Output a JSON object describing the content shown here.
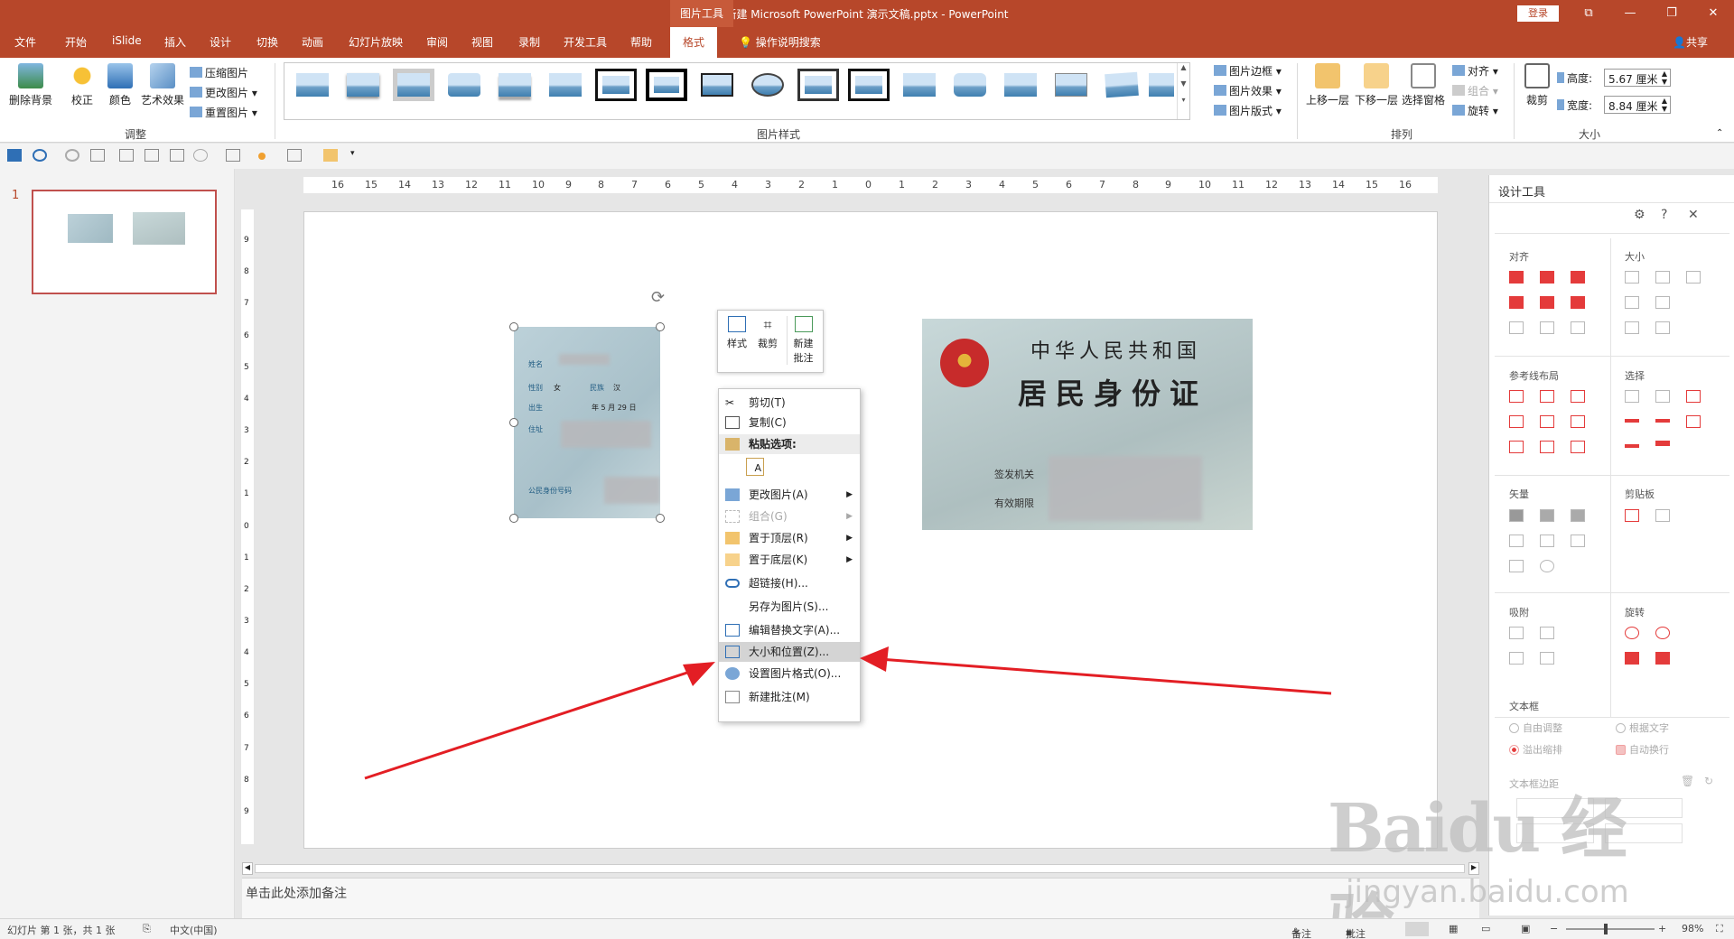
{
  "window": {
    "title": "新建 Microsoft PowerPoint 演示文稿.pptx  -  PowerPoint",
    "context_tab": "图片工具",
    "login": "登录",
    "controls": [
      "⧉",
      "—",
      "❐",
      "✕"
    ]
  },
  "tabs": {
    "items": [
      "文件",
      "开始",
      "iSlide",
      "插入",
      "设计",
      "切换",
      "动画",
      "幻灯片放映",
      "审阅",
      "视图",
      "录制",
      "开发工具",
      "帮助"
    ],
    "active": "格式",
    "search": "操作说明搜索",
    "share": "共享"
  },
  "ribbon": {
    "remove_bg": "删除背景",
    "correct": "校正",
    "color": "颜色",
    "art_effects": "艺术效果",
    "compress": "压缩图片",
    "change": "更改图片",
    "reset": "重置图片",
    "adjust_group": "调整",
    "styles_group": "图片样式",
    "border": "图片边框",
    "effects": "图片效果",
    "layout": "图片版式",
    "bring_forward": "上移一层",
    "send_backward": "下移一层",
    "selection_pane": "选择窗格",
    "align": "对齐",
    "group": "组合",
    "rotate": "旋转",
    "arrange_group": "排列",
    "crop": "裁剪",
    "height_label": "高度:",
    "height_value": "5.67 厘米",
    "width_label": "宽度:",
    "width_value": "8.84 厘米",
    "size_group": "大小"
  },
  "thumbnails": {
    "slide_number": "1"
  },
  "ruler": {
    "ticks": [
      "16",
      "15",
      "14",
      "13",
      "12",
      "11",
      "10",
      "9",
      "8",
      "7",
      "6",
      "5",
      "4",
      "3",
      "2",
      "1",
      "0",
      "1",
      "2",
      "3",
      "4",
      "5",
      "6",
      "7",
      "8",
      "9",
      "10",
      "11",
      "12",
      "13",
      "14",
      "15",
      "16"
    ],
    "vticks": [
      "9",
      "8",
      "7",
      "6",
      "5",
      "4",
      "3",
      "2",
      "1",
      "0",
      "1",
      "2",
      "3",
      "4",
      "5",
      "6",
      "7",
      "8",
      "9"
    ]
  },
  "card_back": {
    "name_label": "姓名",
    "sex_label": "性别",
    "sex_value": "女",
    "ethnic_label": "民族",
    "ethnic_value": "汉",
    "birth_label": "出生",
    "birth_value": "年  5  月 29 日",
    "addr_label": "住址",
    "id_label": "公民身份号码"
  },
  "card_front": {
    "title1": "中华人民共和国",
    "title2": "居民身份证",
    "authority": "签发机关",
    "validity": "有效期限"
  },
  "mini_toolbar": {
    "style": "样式",
    "crop": "裁剪",
    "comment_line1": "新建",
    "comment_line2": "批注"
  },
  "context_menu": {
    "cut": "剪切(T)",
    "copy": "复制(C)",
    "paste_options": "粘贴选项:",
    "change_picture": "更改图片(A)",
    "group": "组合(G)",
    "bring_front": "置于顶层(R)",
    "send_back": "置于底层(K)",
    "hyperlink": "超链接(H)...",
    "save_as": "另存为图片(S)...",
    "alt_text": "编辑替换文字(A)...",
    "size_position": "大小和位置(Z)...",
    "format_picture": "设置图片格式(O)...",
    "new_comment": "新建批注(M)"
  },
  "notes": {
    "placeholder": "单击此处添加备注"
  },
  "panel": {
    "title": "设计工具",
    "align": "对齐",
    "size": "大小",
    "guides": "参考线布局",
    "select": "选择",
    "vector": "矢量",
    "clipboard": "剪贴板",
    "snap": "吸附",
    "rotate": "旋转",
    "textbox": "文本框",
    "free_adjust": "自由调整",
    "fit_text": "根据文字",
    "overflow_shrink": "溢出缩排",
    "auto_wrap": "自动换行",
    "margins": "文本框边距"
  },
  "watermark": {
    "brand": "Baidu 经验",
    "url": "jingyan.baidu.com"
  },
  "status": {
    "slide_info": "幻灯片 第 1 张，共 1 张",
    "language": "中文(中国)",
    "notes": "备注",
    "comments": "批注",
    "zoom": "98%"
  },
  "colors": {
    "accent": "#b7472a",
    "arrow": "#e31e24",
    "panel_icon": "#e43b3b"
  }
}
